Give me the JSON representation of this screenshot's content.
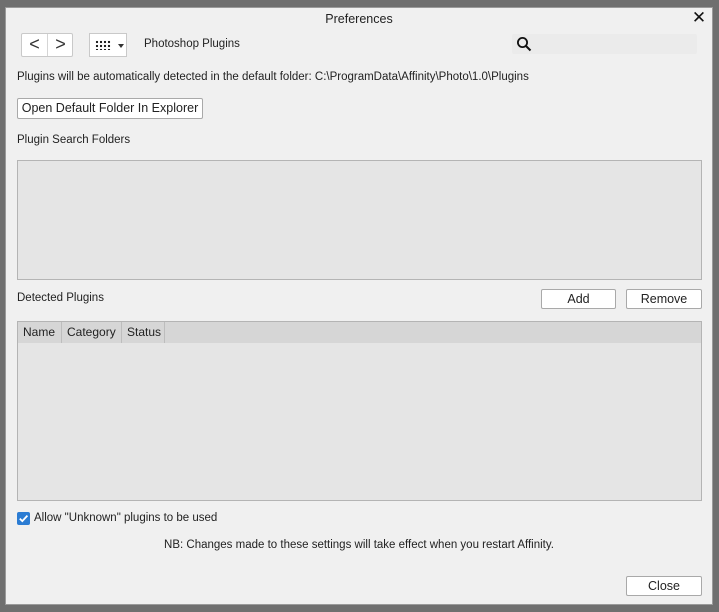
{
  "window": {
    "title": "Preferences",
    "close_glyph": "✕"
  },
  "toolbar": {
    "back_glyph": "<",
    "forward_glyph": ">",
    "section_label": "Photoshop Plugins",
    "search": {
      "placeholder": "",
      "value": ""
    }
  },
  "plugins": {
    "info_text": "Plugins will be automatically detected in the default folder: C:\\ProgramData\\Affinity\\Photo\\1.0\\Plugins",
    "open_folder_label": "Open Default Folder In Explorer",
    "search_folders_label": "Plugin Search Folders",
    "search_folders": [],
    "detected_label": "Detected Plugins",
    "add_label": "Add",
    "remove_label": "Remove",
    "table": {
      "columns": [
        "Name",
        "Category",
        "Status"
      ],
      "rows": []
    },
    "allow_unknown": {
      "label": "Allow \"Unknown\" plugins to be used",
      "checked": true
    },
    "note": "NB: Changes made to these settings will take effect when you restart Affinity."
  },
  "footer": {
    "close_label": "Close"
  },
  "colors": {
    "accent": "#2b7cd3",
    "dialog_bg": "#f0f0f0",
    "panel_bg": "#e5e5e5"
  }
}
